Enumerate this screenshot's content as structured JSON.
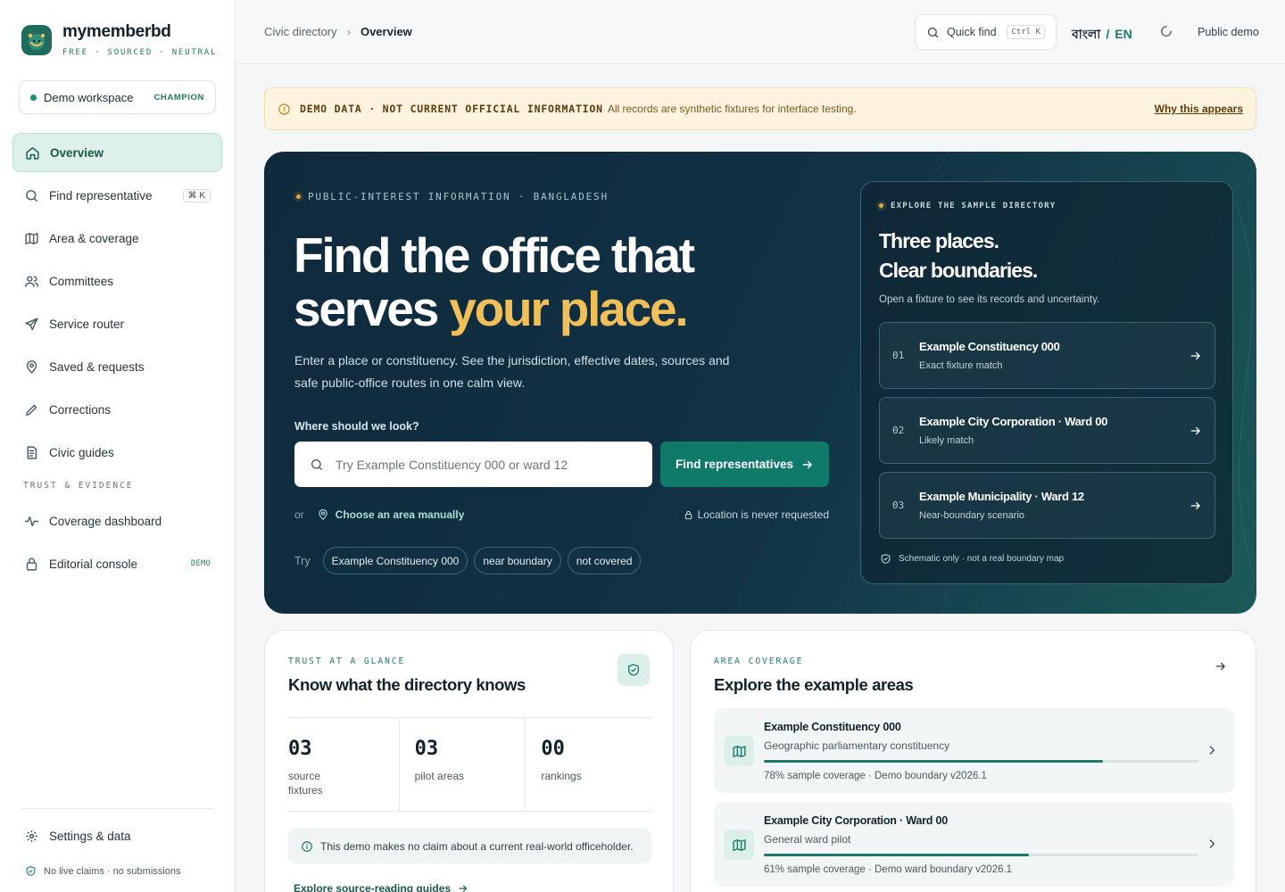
{
  "brand": {
    "name": "mymemberbd",
    "tagline": "FREE · SOURCED · NEUTRAL"
  },
  "workspace": {
    "label": "Demo workspace",
    "badge": "CHAMPION"
  },
  "sidebar": {
    "items": [
      {
        "label": "Overview",
        "icon": "home-icon",
        "active": true
      },
      {
        "label": "Find representative",
        "icon": "search-icon",
        "shortcut": "⌘ K"
      },
      {
        "label": "Area & coverage",
        "icon": "map-icon"
      },
      {
        "label": "Committees",
        "icon": "users-icon"
      },
      {
        "label": "Service router",
        "icon": "send-icon"
      },
      {
        "label": "Saved & requests",
        "icon": "pin-icon"
      },
      {
        "label": "Corrections",
        "icon": "pencil-icon"
      },
      {
        "label": "Civic guides",
        "icon": "document-icon"
      }
    ],
    "section_title": "TRUST & EVIDENCE",
    "trust_items": [
      {
        "label": "Coverage dashboard",
        "icon": "activity-icon"
      },
      {
        "label": "Editorial console",
        "icon": "lock-icon",
        "badge": "DEMO"
      }
    ],
    "settings_label": "Settings & data",
    "footer_note": "No live claims · no submissions"
  },
  "topbar": {
    "breadcrumb": [
      "Civic directory",
      "Overview"
    ],
    "quick_find": {
      "label": "Quick find",
      "shortcut": "Ctrl K"
    },
    "lang_bn": "বাংলা",
    "lang_slash": "/",
    "lang_en": "EN",
    "user": "Public demo"
  },
  "banner": {
    "tag": "DEMO DATA · NOT CURRENT OFFICIAL INFORMATION",
    "text": "All records are synthetic fixtures for interface testing.",
    "link": "Why this appears"
  },
  "hero": {
    "kicker": "PUBLIC-INTEREST INFORMATION · BANGLADESH",
    "title_line1": "Find the office that",
    "title_line2_a": "serves ",
    "title_line2_b": "your place.",
    "subtitle": "Enter a place or constituency. See the jurisdiction, effective dates, sources and safe public-office routes in one calm view.",
    "search_label": "Where should we look?",
    "search_placeholder": "Try Example Constituency 000 or ward 12",
    "search_button": "Find representatives",
    "or_label": "or",
    "manual_link": "Choose an area manually",
    "location_note": "Location is never requested",
    "try_label": "Try",
    "suggestions": [
      "Example Constituency 000",
      "near boundary",
      "not covered"
    ]
  },
  "explore": {
    "kicker": "EXPLORE THE SAMPLE DIRECTORY",
    "title_line1": "Three places.",
    "title_line2": "Clear boundaries.",
    "subtitle": "Open a fixture to see its records and uncertainty.",
    "items": [
      {
        "num": "01",
        "name": "Example Constituency 000",
        "desc": "Exact fixture match"
      },
      {
        "num": "02",
        "name": "Example City Corporation · Ward 00",
        "desc": "Likely match"
      },
      {
        "num": "03",
        "name": "Example Municipality · Ward 12",
        "desc": "Near-boundary scenario"
      }
    ],
    "footer": "Schematic only · not a real boundary map"
  },
  "trust_card": {
    "kicker": "TRUST AT A GLANCE",
    "title": "Know what the directory knows",
    "stats": [
      {
        "value": "03",
        "label": "source fixtures"
      },
      {
        "value": "03",
        "label": "pilot areas"
      },
      {
        "value": "00",
        "label": "rankings"
      }
    ],
    "note": "This demo makes no claim about a current real-world officeholder.",
    "link": "Explore source-reading guides"
  },
  "coverage_card": {
    "kicker": "AREA COVERAGE",
    "title": "Explore the example areas",
    "areas": [
      {
        "name": "Example Constituency 000",
        "type": "Geographic parliamentary constituency",
        "coverage": 0.78,
        "meta": "78% sample coverage · Demo boundary v2026.1"
      },
      {
        "name": "Example City Corporation · Ward 00",
        "type": "General ward pilot",
        "coverage": 0.61,
        "meta": "61% sample coverage · Demo ward boundary v2026.1"
      }
    ]
  },
  "colors": {
    "accent": "#1f7a6a",
    "hero_bg": "#0f2a3c",
    "highlight": "#f1bf57",
    "banner_bg": "#fdf3de"
  }
}
